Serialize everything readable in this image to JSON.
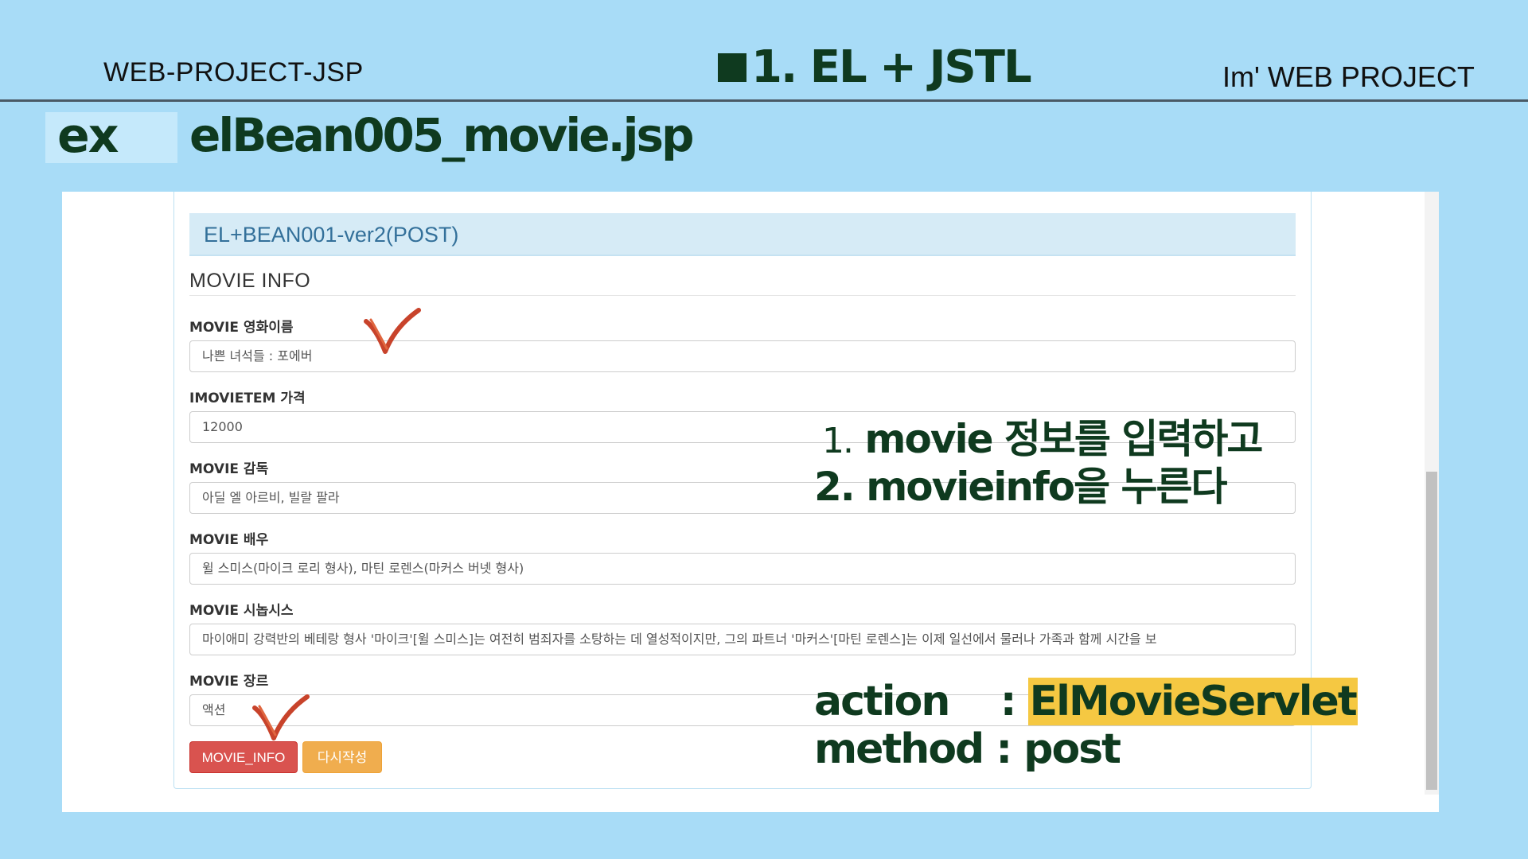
{
  "slide": {
    "header_left": "WEB-PROJECT-JSP",
    "title": "1. EL + JSTL",
    "header_right": "Im'  WEB PROJECT",
    "ex_label": "ex",
    "file_title": "elBean005_movie.jsp"
  },
  "panel": {
    "heading": "EL+BEAN001-ver2(POST)",
    "section_title": "MOVIE INFO"
  },
  "fields": [
    {
      "label": "MOVIE 영화이름",
      "value": "나쁜 녀석들 : 포에버"
    },
    {
      "label": "IMOVIETEM 가격",
      "value": "12000"
    },
    {
      "label": "MOVIE 감독",
      "value": "아딜 엘 아르비, 빌랄 팔라"
    },
    {
      "label": "MOVIE 배우",
      "value": "윌 스미스(마이크 로리 형사), 마틴 로렌스(마커스 버넷 형사)"
    },
    {
      "label": "MOVIE 시놉시스",
      "value": "마이애미 강력반의 베테랑 형사 '마이크'[윌 스미스]는 여전히 범죄자를 소탕하는 데 열성적이지만, 그의 파트너 '마커스'[마틴 로렌스]는 이제 일선에서 물러나 가족과 함께 시간을 보"
    },
    {
      "label": "MOVIE 장르",
      "value": "액션"
    }
  ],
  "buttons": {
    "submit": "MOVIE_INFO",
    "reset": "다시작성"
  },
  "annotations": {
    "step1_num": "1.",
    "step1_text": "movie 정보를 입력하고",
    "step2": "2.  movieinfo을 누른다",
    "action_label": "action    : ",
    "action_value": "ElMovieServlet",
    "method": "method : post"
  },
  "colors": {
    "background": "#a8dcf7",
    "title_green": "#0f3a1f",
    "danger": "#d9534f",
    "warning": "#f0ad4e",
    "highlight": "#f5c842",
    "check_mark": "#c8432b"
  }
}
